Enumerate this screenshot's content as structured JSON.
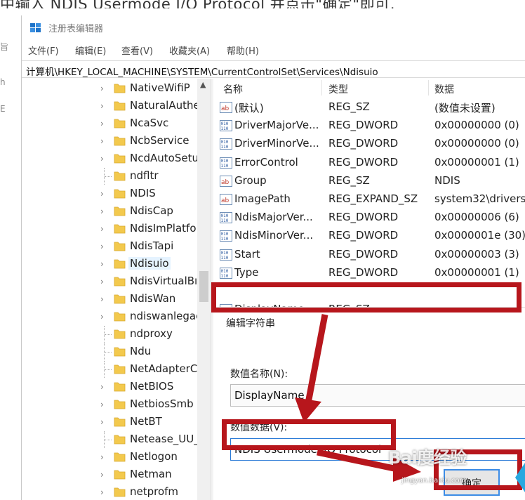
{
  "caption_fragment": "中输入 NDIS Usermode I/O Protocol 并点击\"确定\"即可,",
  "side_fragments": [
    "旨",
    "h",
    "E"
  ],
  "window": {
    "title": "注册表编辑器",
    "menu": [
      "文件(F)",
      "编辑(E)",
      "查看(V)",
      "收藏夹(A)",
      "帮助(H)"
    ],
    "address": "计算机\\HKEY_LOCAL_MACHINE\\SYSTEM\\CurrentControlSet\\Services\\Ndisuio"
  },
  "tree": {
    "items": [
      {
        "label": "NativeWifiP",
        "expandable": true
      },
      {
        "label": "NaturalAuthe",
        "expandable": true
      },
      {
        "label": "NcaSvc",
        "expandable": true
      },
      {
        "label": "NcbService",
        "expandable": true
      },
      {
        "label": "NcdAutoSetu",
        "expandable": true
      },
      {
        "label": "ndfltr",
        "expandable": false
      },
      {
        "label": "NDIS",
        "expandable": true
      },
      {
        "label": "NdisCap",
        "expandable": true
      },
      {
        "label": "NdisImPlatfo",
        "expandable": true
      },
      {
        "label": "NdisTapi",
        "expandable": true
      },
      {
        "label": "Ndisuio",
        "expandable": true,
        "selected": true
      },
      {
        "label": "NdisVirtualBı",
        "expandable": true
      },
      {
        "label": "NdisWan",
        "expandable": true
      },
      {
        "label": "ndiswanlegac",
        "expandable": true
      },
      {
        "label": "ndproxy",
        "expandable": false
      },
      {
        "label": "Ndu",
        "expandable": false
      },
      {
        "label": "NetAdapterC",
        "expandable": false
      },
      {
        "label": "NetBIOS",
        "expandable": true
      },
      {
        "label": "NetbiosSmb",
        "expandable": true
      },
      {
        "label": "NetBT",
        "expandable": true
      },
      {
        "label": "Netease_UU_",
        "expandable": false
      },
      {
        "label": "Netlogon",
        "expandable": true
      },
      {
        "label": "Netman",
        "expandable": true
      },
      {
        "label": "netprofm",
        "expandable": true
      }
    ]
  },
  "values": {
    "columns": [
      "名称",
      "类型",
      "数据"
    ],
    "rows": [
      {
        "icon": "string-value-icon",
        "name": "(默认)",
        "type": "REG_SZ",
        "data": "(数值未设置)"
      },
      {
        "icon": "binary-value-icon",
        "name": "DriverMajorVe...",
        "type": "REG_DWORD",
        "data": "0x00000000 (0)"
      },
      {
        "icon": "binary-value-icon",
        "name": "DriverMinorVe...",
        "type": "REG_DWORD",
        "data": "0x00000000 (0)"
      },
      {
        "icon": "binary-value-icon",
        "name": "ErrorControl",
        "type": "REG_DWORD",
        "data": "0x00000001 (1)"
      },
      {
        "icon": "string-value-icon",
        "name": "Group",
        "type": "REG_SZ",
        "data": "NDIS"
      },
      {
        "icon": "string-value-icon",
        "name": "ImagePath",
        "type": "REG_EXPAND_SZ",
        "data": "system32\\drivers\\"
      },
      {
        "icon": "binary-value-icon",
        "name": "NdisMajorVer...",
        "type": "REG_DWORD",
        "data": "0x00000006 (6)"
      },
      {
        "icon": "binary-value-icon",
        "name": "NdisMinorVer...",
        "type": "REG_DWORD",
        "data": "0x0000001e (30)"
      },
      {
        "icon": "binary-value-icon",
        "name": "Start",
        "type": "REG_DWORD",
        "data": "0x00000003 (3)"
      },
      {
        "icon": "binary-value-icon",
        "name": "Type",
        "type": "REG_DWORD",
        "data": "0x00000001 (1)"
      }
    ],
    "new_row": {
      "icon": "string-value-icon",
      "name": "DisplayName",
      "type": "REG_SZ"
    }
  },
  "dialog": {
    "title": "编辑字符串",
    "name_label": "数值名称(N):",
    "name_value": "DisplayName",
    "data_label": "数值数据(V):",
    "data_value": "NDIS Usermode I/O Protocol",
    "ok_label": "确定"
  },
  "watermark": {
    "text": "Bai度经验",
    "sub": "jingyan.baidu.com"
  },
  "colors": {
    "highlight": "#b7161c",
    "arrow": "#b7161c",
    "accent": "#2a7ad6",
    "folder": "#f3c94d"
  }
}
